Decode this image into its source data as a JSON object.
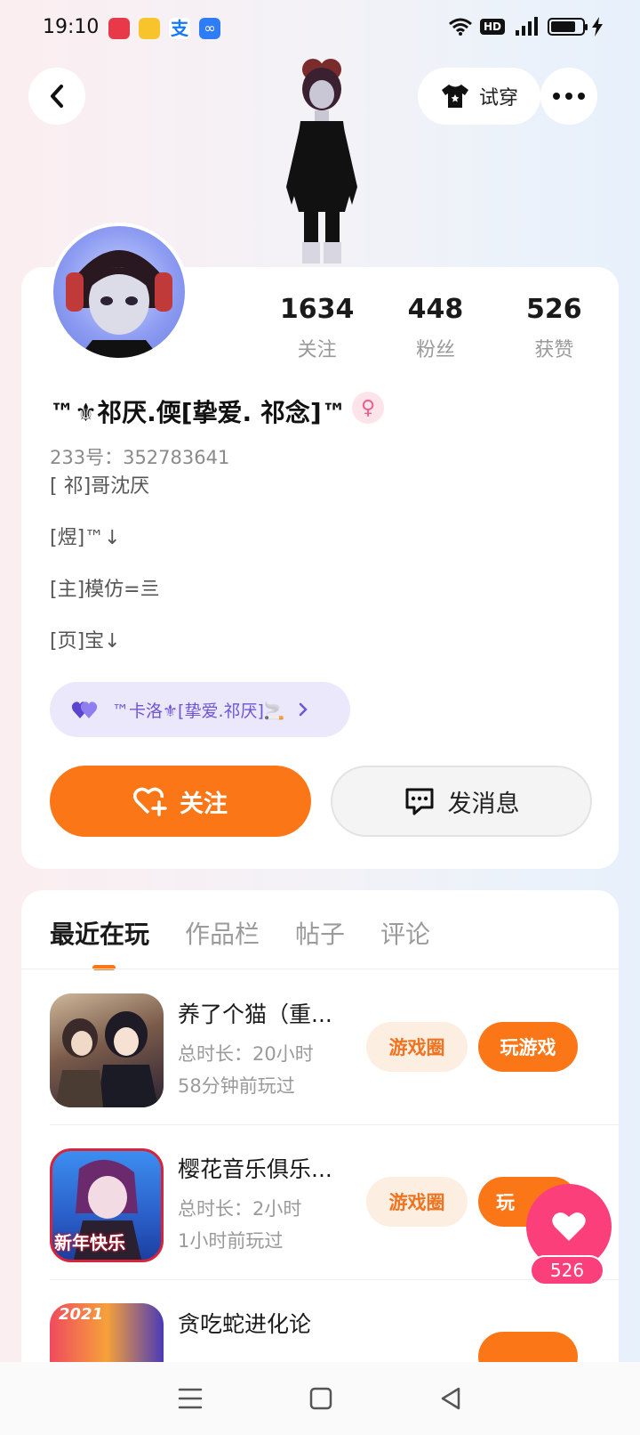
{
  "status_bar": {
    "time": "19:10",
    "hd": "HD",
    "network": "4G",
    "battery_level": 0.8
  },
  "header": {
    "tryon_label": "试穿"
  },
  "profile": {
    "stats": [
      {
        "value": "1634",
        "label": "关注"
      },
      {
        "value": "448",
        "label": "粉丝"
      },
      {
        "value": "526",
        "label": "获赞"
      }
    ],
    "nickname": "™⚜祁厌.偄[挚爱. 祁念]™",
    "gender_icon": "female-icon",
    "uid": "233号：352783641",
    "bio": [
      "[ 祁]哥沈厌",
      "[煜]™↓",
      "[主]模仿=亖",
      "[页]宝↓"
    ],
    "guild": "™卡洛⚜[挚爱.祁厌]🚬",
    "follow_label": "关注",
    "message_label": "发消息"
  },
  "tabs": [
    "最近在玩",
    "作品栏",
    "帖子",
    "评论"
  ],
  "games": [
    {
      "title": "养了个猫（重...",
      "duration": "总时长：20小时",
      "last_played": "58分钟前玩过",
      "circle_label": "游戏圈",
      "play_label": "玩游戏"
    },
    {
      "title": "樱花音乐俱乐...",
      "duration": "总时长：2小时",
      "last_played": "1小时前玩过",
      "circle_label": "游戏圈",
      "play_label": "玩",
      "icon_text": "新年快乐"
    },
    {
      "title": "贪吃蛇进化论",
      "icon_text": "2021"
    }
  ],
  "like_float": {
    "count": "526"
  },
  "colors": {
    "accent": "#fb7617",
    "like": "#fb3f7b",
    "guild": "#6c55d6"
  }
}
